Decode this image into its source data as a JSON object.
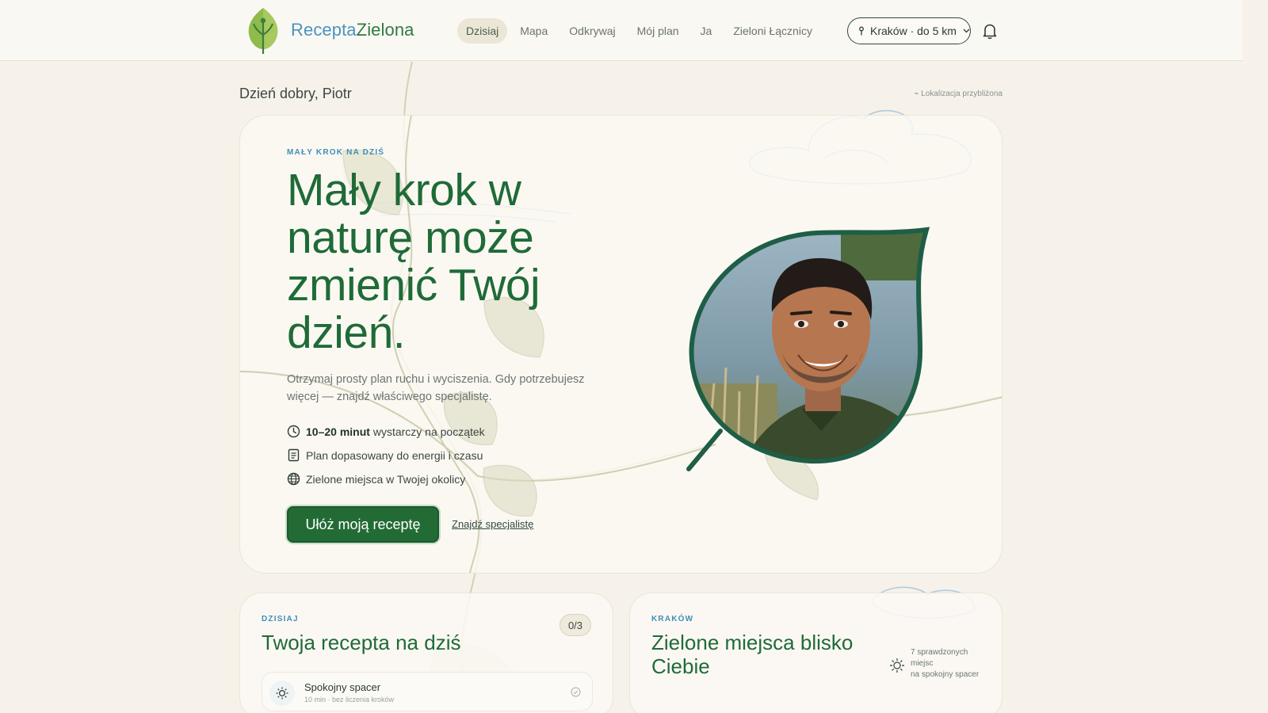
{
  "header": {
    "brand_part1": "Recepta",
    "brand_part2": "Zielona",
    "nav": [
      {
        "label": "Dzisiaj",
        "active": true
      },
      {
        "label": "Mapa",
        "active": false
      },
      {
        "label": "Odkrywaj",
        "active": false
      },
      {
        "label": "Mój plan",
        "active": false
      },
      {
        "label": "Ja",
        "active": false
      },
      {
        "label": "Zieloni Łącznicy",
        "active": false
      }
    ],
    "location": "Kraków · do 5 km",
    "icons": {
      "location": "pin-icon",
      "dropdown": "chevron-down-icon",
      "notifications": "bell-icon"
    }
  },
  "greeting": "Dzień dobry, Piotr",
  "location_note": "Lokalizacja przybliżona",
  "hero": {
    "eyebrow": "MAŁY KROK NA DZIŚ",
    "title": "Mały krok w naturę może zmienić Twój dzień.",
    "subtitle": "Otrzymaj prosty plan ruchu i wyciszenia. Gdy potrzebujesz więcej — znajdź właściwego specjalistę.",
    "features": [
      {
        "icon": "clock-icon",
        "bold": "10–20 minut",
        "text": " wystarczy na początek"
      },
      {
        "icon": "document-icon",
        "bold": "",
        "text": "Plan dopasowany do energii i czasu"
      },
      {
        "icon": "globe-icon",
        "bold": "",
        "text": "Zielone miejsca w Twojej okolicy"
      }
    ],
    "cta_label": "Ułóż moją receptę",
    "secondary_link": "Znajdź specjalistę"
  },
  "card_today": {
    "eyebrow": "DZISIAJ",
    "title": "Twoja recepta na dziś",
    "counter": "0/3",
    "task": {
      "title": "Spokojny spacer",
      "meta": "10 min · bez liczenia kroków"
    }
  },
  "card_places": {
    "eyebrow": "KRAKÓW",
    "title": "Zielone miejsca blisko Ciebie",
    "note_line1": "7 sprawdzonych",
    "note_line2": "miejsc",
    "note_line3": "na spokojny spacer"
  },
  "colors": {
    "brand_blue": "#4a94c0",
    "brand_green": "#2f7a44",
    "primary_green": "#236b35",
    "background": "#f6f2ea"
  }
}
